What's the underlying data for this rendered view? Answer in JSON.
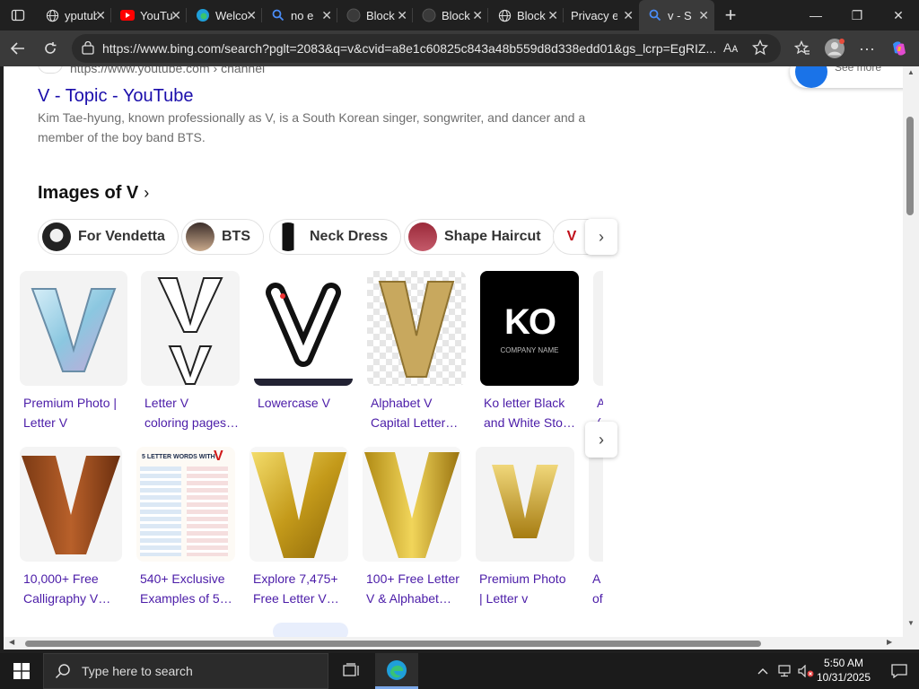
{
  "browser": {
    "tabs": [
      {
        "title": "yputube"
      },
      {
        "title": "YouTube"
      },
      {
        "title": "Welcome"
      },
      {
        "title": "no e"
      },
      {
        "title": "Block"
      },
      {
        "title": "Block"
      },
      {
        "title": "Block"
      },
      {
        "title": "Privacy e"
      },
      {
        "title": "v - S"
      }
    ],
    "url": "https://www.bing.com/search?pglt=2083&q=v&cvid=a8e1c60825c843a48b559d8d338edd01&gs_lcrp=EgRIZ...",
    "reader_label": "Aᴀ"
  },
  "result": {
    "cite": "https://www.youtube.com › channel",
    "title": "V - Topic - YouTube",
    "snippet": "Kim Tae-hyung, known professionally as V, is a South Korean singer, songwriter, and dancer and a member of the boy band BTS."
  },
  "see_more": "See more",
  "images": {
    "heading": "Images of V",
    "pills": [
      "For Vendetta",
      "BTS",
      "Neck Dress",
      "Shape Haircut"
    ],
    "row1": [
      {
        "caption_1": "Premium Photo |",
        "caption_2": "Letter V"
      },
      {
        "caption_1": "Letter V",
        "caption_2": "coloring pages…"
      },
      {
        "caption_1": "Lowercase V",
        "caption_2": ""
      },
      {
        "caption_1": "Alphabet V",
        "caption_2": "Capital Letter…"
      },
      {
        "caption_1": "Ko letter Black",
        "caption_2": "and White Sto…",
        "ko_text": "KO",
        "ko_sub": "COMPANY NAME"
      },
      {
        "caption_1": "A",
        "caption_2": "("
      }
    ],
    "row2": [
      {
        "caption_1": "10,000+ Free",
        "caption_2": "Calligraphy V…"
      },
      {
        "caption_1": "540+ Exclusive",
        "caption_2": "Examples of 5…",
        "poster_title": "5 LETTER WORDS WITH"
      },
      {
        "caption_1": "Explore 7,475+",
        "caption_2": "Free Letter V…"
      },
      {
        "caption_1": "100+ Free Letter",
        "caption_2": "V & Alphabet…"
      },
      {
        "caption_1": "Premium Photo",
        "caption_2": "| Letter v"
      },
      {
        "caption_1": "A",
        "caption_2": "of"
      }
    ]
  },
  "taskbar": {
    "search_placeholder": "Type here to search",
    "time": "5:50 AM",
    "date": "10/31/2025"
  },
  "colors": {
    "link": "#1a0dab",
    "visited_caption": "#4b1ca8",
    "gold": "#d4af37"
  }
}
